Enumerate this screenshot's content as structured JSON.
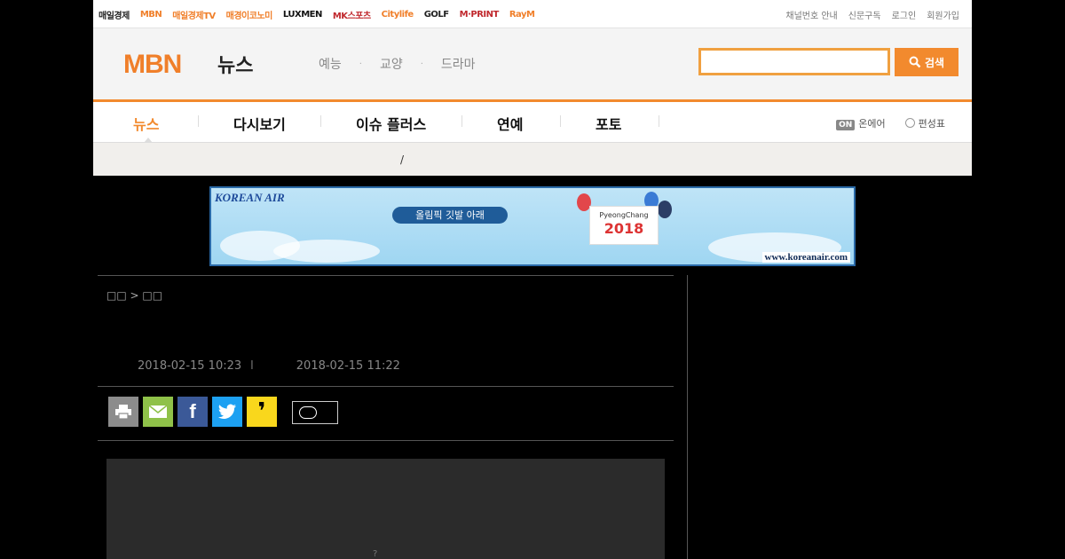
{
  "family_links": [
    {
      "label": "매일경제",
      "color": "#222222"
    },
    {
      "label": "MBN",
      "color": "#f07f2a"
    },
    {
      "label": "매일경제TV",
      "color": "#f07f2a"
    },
    {
      "label": "매경이코노미",
      "color": "#f07f2a"
    },
    {
      "label": "LUXMEN",
      "color": "#111111"
    },
    {
      "label": "MK스포츠",
      "color": "#c0282d"
    },
    {
      "label": "Citylife",
      "color": "#f07f2a"
    },
    {
      "label": "GOLF",
      "color": "#222222"
    },
    {
      "label": "M·PRINT",
      "color": "#c0282d"
    },
    {
      "label": "RayM",
      "color": "#f07f2a"
    }
  ],
  "utils": [
    "채널번호 안내",
    "신문구독",
    "로그인",
    "회원가입"
  ],
  "logo": {
    "main": "MBN",
    "sub": "뉴스"
  },
  "categories": [
    "예능",
    "교양",
    "드라마"
  ],
  "category_dot": "·",
  "search": {
    "button_label": "검색",
    "placeholder": ""
  },
  "gnb": {
    "items": [
      "뉴스",
      "다시보기",
      "이슈 플러스",
      "연예",
      "포토"
    ],
    "onair_badge": "ON",
    "onair": "온에어",
    "schedule": "편성표"
  },
  "subnav": {
    "separator": "/"
  },
  "ad": {
    "brand": "KOREAN AIR",
    "banner_text": "올림픽 깃발 아래",
    "games_name": "PyeongChang",
    "games_year": "2018",
    "url": "www.koreanair.com"
  },
  "article": {
    "breadcrumb": "□□ > □□",
    "date_input": "2018-02-15 10:23",
    "date_sep": "l",
    "date_modified": "2018-02-15 11:22",
    "photo_caption": "?"
  },
  "share": {
    "print_color": "#8c8c8c",
    "mail_color": "#8fc149",
    "facebook_color": "#3b5998",
    "twitter_color": "#1da1f2",
    "kakao_color": "#f9d71c",
    "facebook_glyph": "f",
    "kakao_glyph": "❜"
  },
  "colors": {
    "accent": "#f28a2e"
  }
}
